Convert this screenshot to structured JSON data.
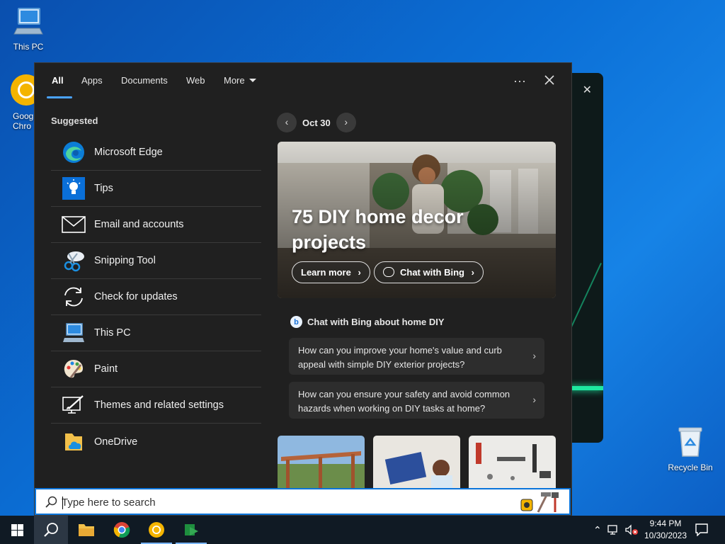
{
  "desktop": {
    "icons": [
      {
        "label": "This PC"
      },
      {
        "label": "Goog\nChro"
      },
      {
        "label": "Recycle Bin"
      }
    ]
  },
  "search": {
    "tabs": [
      "All",
      "Apps",
      "Documents",
      "Web",
      "More"
    ],
    "active_tab": "All",
    "suggested_title": "Suggested",
    "apps": [
      {
        "label": "Microsoft Edge",
        "icon": "edge-icon"
      },
      {
        "label": "Tips",
        "icon": "tips-icon"
      },
      {
        "label": "Email and accounts",
        "icon": "mail-icon"
      },
      {
        "label": "Snipping Tool",
        "icon": "snipping-tool-icon"
      },
      {
        "label": "Check for updates",
        "icon": "sync-icon"
      },
      {
        "label": "This PC",
        "icon": "computer-icon"
      },
      {
        "label": "Paint",
        "icon": "paint-icon"
      },
      {
        "label": "Themes and related settings",
        "icon": "themes-icon"
      },
      {
        "label": "OneDrive",
        "icon": "onedrive-icon"
      }
    ],
    "date": "Oct 30",
    "hero": {
      "title": "75 DIY home decor projects",
      "learn_more": "Learn more",
      "chat_with_bing": "Chat with Bing"
    },
    "bing_heading": "Chat with Bing about home DIY",
    "questions": [
      "How can you improve your home's value and curb appeal with simple DIY exterior projects?",
      "How can you ensure your safety and avoid common hazards when working on DIY tasks at home?"
    ],
    "placeholder": "Type here to search"
  },
  "taskbar": {
    "time": "9:44 PM",
    "date": "10/30/2023"
  },
  "colors": {
    "accent": "#0a74da",
    "panel_bg": "#202020",
    "taskbar_bg": "#101a24"
  }
}
